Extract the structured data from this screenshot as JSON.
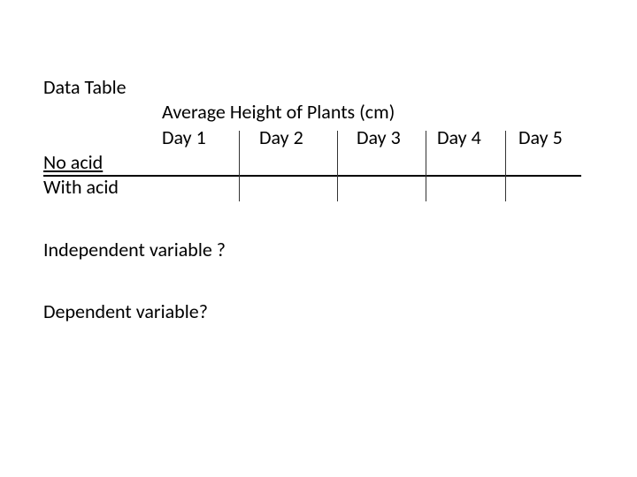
{
  "title": "Data Table",
  "table_title": "Average Height of Plants (cm)",
  "columns": [
    "Day 1",
    "Day 2",
    "Day 3",
    "Day 4",
    "Day 5"
  ],
  "rows": [
    "No acid",
    "With acid"
  ],
  "questions": {
    "independent": "Independent variable ?",
    "dependent": "Dependent variable?"
  },
  "chart_data": {
    "type": "table",
    "title": "Average Height of Plants (cm)",
    "columns": [
      "",
      "Day 1",
      "Day 2",
      "Day 3",
      "Day 4",
      "Day 5"
    ],
    "rows": [
      [
        "No acid",
        "",
        "",
        "",
        "",
        ""
      ],
      [
        "With acid",
        "",
        "",
        "",
        "",
        ""
      ]
    ]
  }
}
